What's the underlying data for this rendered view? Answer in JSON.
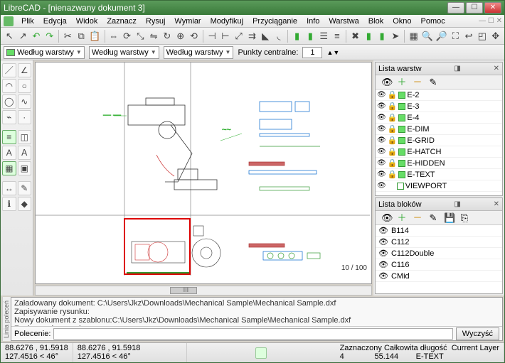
{
  "window": {
    "title": "LibreCAD - [nienazwany dokument 3]"
  },
  "menu": {
    "items": [
      "Plik",
      "Edycja",
      "Widok",
      "Zaznacz",
      "Rysuj",
      "Wymiar",
      "Modyfikuj",
      "Przyciąganie",
      "Info",
      "Warstwa",
      "Blok",
      "Okno",
      "Pomoc"
    ]
  },
  "layerbar": {
    "combo1": "Według warstwy",
    "combo2": "Według warstwy",
    "combo3": "Według warstwy",
    "snap_label": "Punkty centralne:",
    "snap_value": "1"
  },
  "canvas": {
    "zoom_label": "10 / 100",
    "scroll_marker": "III"
  },
  "layers_panel": {
    "title": "Lista warstw",
    "items": [
      "E-2",
      "E-3",
      "E-4",
      "E-DIM",
      "E-GRID",
      "E-HATCH",
      "E-HIDDEN",
      "E-TEXT",
      "VIEWPORT"
    ]
  },
  "blocks_panel": {
    "title": "Lista bloków",
    "items": [
      "B114",
      "C112",
      "C112Double",
      "C116",
      "CMid"
    ]
  },
  "cmd": {
    "side_label": "Linia poleceń",
    "log1": "Załadowany dokument: C:\\Users\\Jkz\\Downloads\\Mechanical Sample\\Mechanical Sample.dxf",
    "log2": "Zapisywanie rysunku:",
    "log3": "Nowy dokument z szablonu:C:\\Users\\Jkz\\Downloads\\Mechanical Sample\\Mechanical Sample.dxf",
    "log4": "Zapisywanie rysunku:",
    "prompt": "Polecenie:",
    "clear": "Wyczyść"
  },
  "status": {
    "coords1a": "88.6276 , 91.5918",
    "coords1b": "127.4516 < 46°",
    "coords2a": "88.6276 , 91.5918",
    "coords2b": "127.4516 < 46°",
    "sel_label": "Zaznaczony",
    "sel_val": "4",
    "len_label": "Całkowita długość",
    "len_val": "55.144",
    "layer_label": "Current Layer",
    "layer_val": "E-TEXT"
  }
}
